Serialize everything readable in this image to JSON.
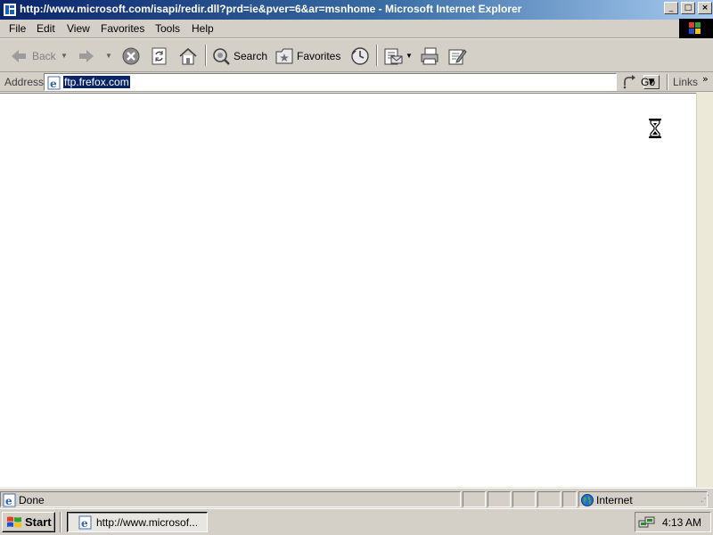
{
  "window": {
    "title": "http://www.microsoft.com/isapi/redir.dll?prd=ie&pver=6&ar=msnhome - Microsoft Internet Explorer",
    "min_symbol": "_",
    "max_symbol": "□",
    "close_symbol": "×"
  },
  "menu": {
    "file": "File",
    "edit": "Edit",
    "view": "View",
    "favorites": "Favorites",
    "tools": "Tools",
    "help": "Help"
  },
  "toolbar": {
    "back_label": "Back",
    "search_label": "Search",
    "favorites_label": "Favorites"
  },
  "address": {
    "label": "Address",
    "value": "ftp.frefox.com",
    "go_label": "Go",
    "links_label": "Links",
    "links_chevron": "»"
  },
  "status": {
    "text": "Done",
    "zone": "Internet"
  },
  "taskbar": {
    "start_label": "Start",
    "task_label": "http://www.microsof...",
    "clock": "4:13 AM"
  },
  "icons": {
    "back": "back-arrow-icon",
    "forward": "forward-arrow-icon",
    "stop": "stop-icon",
    "refresh": "refresh-icon",
    "home": "home-icon",
    "search": "search-icon",
    "favorites": "favorites-star-icon",
    "history": "history-icon",
    "mail": "mail-icon",
    "print": "print-icon",
    "edit": "edit-icon",
    "busy": "hourglass-icon",
    "zone": "globe-icon"
  },
  "colors": {
    "titlebar_start": "#0a246a",
    "titlebar_end": "#a6caf0",
    "selection": "#0a246a",
    "chrome": "#d4d0c8"
  }
}
